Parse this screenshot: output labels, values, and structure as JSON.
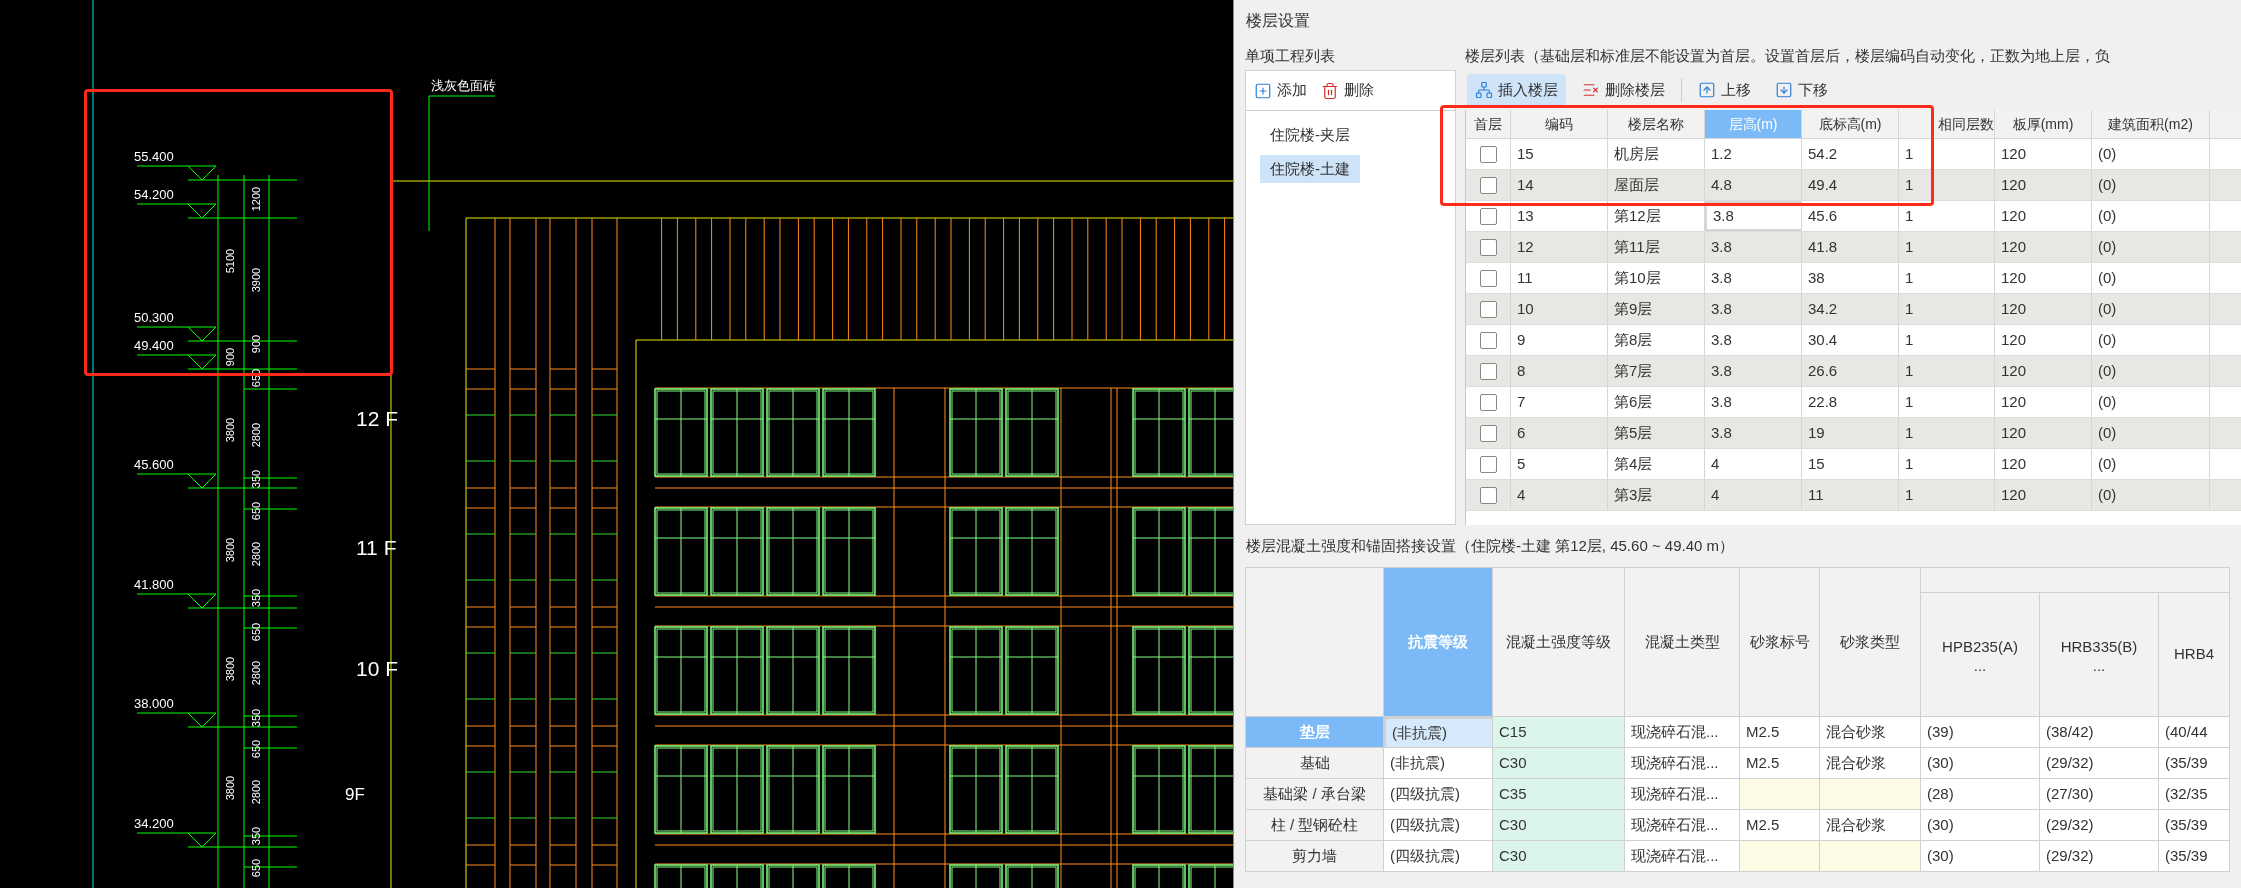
{
  "cad": {
    "callout": "浅灰色面砖",
    "elevations": [
      "55.400",
      "54.200",
      "50.300",
      "49.400",
      "45.600",
      "41.800",
      "38.000",
      "34.200"
    ],
    "dimensions_total": [
      "5100",
      "900",
      "3800",
      "3800",
      "3800",
      "3800"
    ],
    "dimensions_detail": [
      "1200",
      "3900",
      "900",
      "650",
      "2800",
      "350",
      "650",
      "2800",
      "350",
      "650",
      "2800",
      "350",
      "650",
      "2800",
      "350",
      "650"
    ],
    "floor_labels": [
      "12 F",
      "11 F",
      "10 F",
      "9F"
    ]
  },
  "dialog": {
    "title": "楼层设置",
    "project_list": {
      "label": "单项工程列表",
      "toolbar": [
        {
          "label": "添加",
          "kind": "add"
        },
        {
          "label": "删除",
          "kind": "delete"
        }
      ],
      "items": [
        {
          "label": "住院楼-夹层",
          "selected": false
        },
        {
          "label": "住院楼-土建",
          "selected": true
        }
      ]
    },
    "floor_list": {
      "label": "楼层列表（基础层和标准层不能设置为首层。设置首层后，楼层编码自动变化，正数为地上层，负",
      "toolbar": [
        {
          "label": "插入楼层",
          "kind": "insert",
          "selected": true
        },
        {
          "label": "删除楼层",
          "kind": "remove",
          "selected": false
        },
        {
          "label": "上移",
          "kind": "up",
          "selected": false
        },
        {
          "label": "下移",
          "kind": "down",
          "selected": false
        }
      ],
      "checkbox_column": {
        "label": "首层"
      },
      "columns": [
        {
          "label": "编码",
          "selected": false
        },
        {
          "label": "楼层名称",
          "selected": false
        },
        {
          "label": "层高(m)",
          "selected": true
        },
        {
          "label": "底标高(m)",
          "selected": false
        },
        {
          "label": "相同层数",
          "selected": false
        },
        {
          "label": "板厚(mm)",
          "selected": false
        },
        {
          "label": "建筑面积(m2)",
          "selected": false
        }
      ],
      "rows": [
        {
          "first": false,
          "current": false,
          "cells": [
            "15",
            "机房层",
            "1.2",
            "54.2",
            "1",
            "120",
            "(0)"
          ]
        },
        {
          "first": false,
          "current": false,
          "cells": [
            "14",
            "屋面层",
            "4.8",
            "49.4",
            "1",
            "120",
            "(0)"
          ]
        },
        {
          "first": false,
          "current": true,
          "cells": [
            "13",
            "第12层",
            "3.8",
            "45.6",
            "1",
            "120",
            "(0)"
          ]
        },
        {
          "first": false,
          "current": false,
          "cells": [
            "12",
            "第11层",
            "3.8",
            "41.8",
            "1",
            "120",
            "(0)"
          ]
        },
        {
          "first": false,
          "current": false,
          "cells": [
            "11",
            "第10层",
            "3.8",
            "38",
            "1",
            "120",
            "(0)"
          ]
        },
        {
          "first": false,
          "current": false,
          "cells": [
            "10",
            "第9层",
            "3.8",
            "34.2",
            "1",
            "120",
            "(0)"
          ]
        },
        {
          "first": false,
          "current": false,
          "cells": [
            "9",
            "第8层",
            "3.8",
            "30.4",
            "1",
            "120",
            "(0)"
          ]
        },
        {
          "first": false,
          "current": false,
          "cells": [
            "8",
            "第7层",
            "3.8",
            "26.6",
            "1",
            "120",
            "(0)"
          ]
        },
        {
          "first": false,
          "current": false,
          "cells": [
            "7",
            "第6层",
            "3.8",
            "22.8",
            "1",
            "120",
            "(0)"
          ]
        },
        {
          "first": false,
          "current": false,
          "cells": [
            "6",
            "第5层",
            "3.8",
            "19",
            "1",
            "120",
            "(0)"
          ]
        },
        {
          "first": false,
          "current": false,
          "cells": [
            "5",
            "第4层",
            "4",
            "15",
            "1",
            "120",
            "(0)"
          ]
        },
        {
          "first": false,
          "current": false,
          "cells": [
            "4",
            "第3层",
            "4",
            "11",
            "1",
            "120",
            "(0)"
          ]
        }
      ]
    },
    "concrete": {
      "title": "楼层混凝土强度和锚固搭接设置（住院楼-土建  第12层, 45.60 ~ 49.40 m）",
      "columns": [
        {
          "label": "抗震等级",
          "selected": true
        },
        {
          "label": "混凝土强度等级",
          "selected": false
        },
        {
          "label": "混凝土类型",
          "selected": false
        },
        {
          "label": "砂浆标号",
          "selected": false
        },
        {
          "label": "砂浆类型",
          "selected": false
        }
      ],
      "rebar_columns": [
        {
          "label": "HPB235(A)",
          "sub": "..."
        },
        {
          "label": "HRB335(B)",
          "sub": "..."
        },
        {
          "label": "HRB4"
        }
      ],
      "rows": [
        {
          "label": "垫层",
          "selected": true,
          "cells": [
            "(非抗震)",
            "C15",
            "现浇碎石混...",
            "M2.5",
            "混合砂浆",
            "(39)",
            "(38/42)",
            "(40/44"
          ]
        },
        {
          "label": "基础",
          "selected": false,
          "cells": [
            "(非抗震)",
            "C30",
            "现浇碎石混...",
            "M2.5",
            "混合砂浆",
            "(30)",
            "(29/32)",
            "(35/39"
          ]
        },
        {
          "label": "基础梁 / 承台梁",
          "selected": false,
          "cells": [
            "(四级抗震)",
            "C35",
            "现浇碎石混...",
            null,
            null,
            "(28)",
            "(27/30)",
            "(32/35"
          ]
        },
        {
          "label": "柱 / 型钢砼柱",
          "selected": false,
          "cells": [
            "(四级抗震)",
            "C30",
            "现浇碎石混...",
            "M2.5",
            "混合砂浆",
            "(30)",
            "(29/32)",
            "(35/39"
          ]
        },
        {
          "label": "剪力墙",
          "selected": false,
          "cells": [
            "(四级抗震)",
            "C30",
            "现浇碎石混...",
            null,
            null,
            "(30)",
            "(29/32)",
            "(35/39"
          ]
        }
      ]
    }
  }
}
